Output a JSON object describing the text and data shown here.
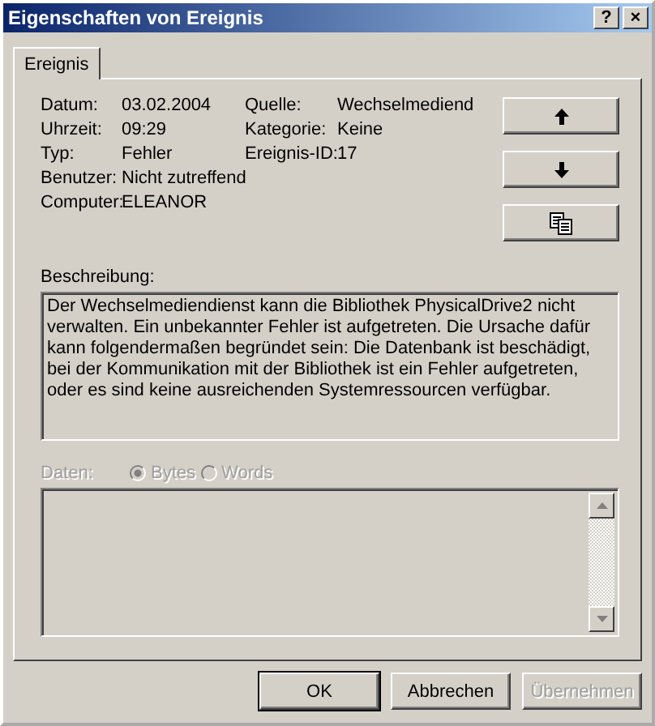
{
  "window": {
    "title": "Eigenschaften von Ereignis",
    "help_button": "?",
    "close_button": "×"
  },
  "tabs": [
    {
      "label": "Ereignis",
      "selected": true
    }
  ],
  "fields": [
    {
      "label": "Datum:",
      "value": "03.02.2004"
    },
    {
      "label": "Quelle:",
      "value": "Wechselmediend"
    },
    {
      "label": "Uhrzeit:",
      "value": "09:29"
    },
    {
      "label": "Kategorie:",
      "value": "Keine"
    },
    {
      "label": "Typ:",
      "value": "Fehler"
    },
    {
      "label": "Ereignis-ID:",
      "value": "17"
    },
    {
      "label": "Benutzer:",
      "value": "Nicht zutreffend"
    },
    {
      "label": "Computer:",
      "value": "ELEANOR"
    }
  ],
  "side_buttons": [
    {
      "kind": "up"
    },
    {
      "kind": "down"
    },
    {
      "kind": "copy"
    }
  ],
  "description": {
    "label": "Beschreibung:",
    "text": "Der Wechselmediendienst kann die Bibliothek PhysicalDrive2 nicht verwalten. Ein unbekannter Fehler ist aufgetreten. Die Ursache dafür kann folgendermaßen begründet sein: Die Datenbank ist beschädigt, bei der Kommunikation mit der Bibliothek ist ein Fehler aufgetreten, oder es sind keine ausreichenden Systemressourcen verfügbar."
  },
  "data": {
    "label": "Daten:",
    "disabled": true,
    "options": [
      {
        "label": "Bytes",
        "selected": true
      },
      {
        "label": "Words",
        "selected": false
      }
    ]
  },
  "buttons": [
    {
      "label": "OK",
      "default": true,
      "disabled": false
    },
    {
      "label": "Abbrechen",
      "default": false,
      "disabled": false
    },
    {
      "label": "Übernehmen",
      "default": false,
      "disabled": true
    }
  ]
}
